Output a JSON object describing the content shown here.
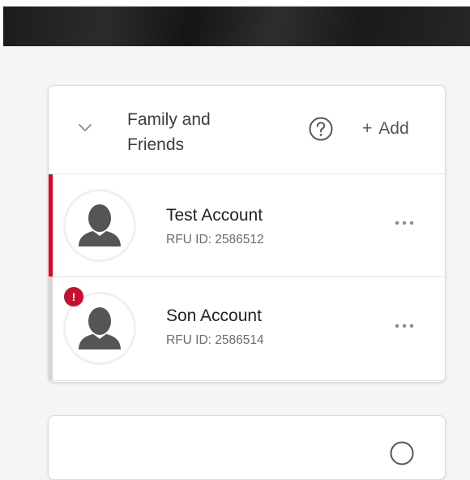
{
  "family_card": {
    "title": "Family and Friends",
    "add_label": "Add",
    "add_icon": "+",
    "members": [
      {
        "name": "Test Account",
        "rfu_id": "RFU ID: 2586512",
        "selected": true,
        "alert": false
      },
      {
        "name": "Son Account",
        "rfu_id": "RFU ID: 2586514",
        "selected": false,
        "alert": true,
        "alert_symbol": "!"
      }
    ]
  },
  "colors": {
    "accent_red": "#c8102e",
    "text_primary": "#222222",
    "text_secondary": "#6b6b6b",
    "avatar_gray": "#555555"
  },
  "icons": {
    "collapse": "chevron-down-icon",
    "help": "question-circle-icon",
    "more": "more-horizontal-icon",
    "avatar": "person-silhouette-icon",
    "alert": "exclamation-badge-icon"
  }
}
